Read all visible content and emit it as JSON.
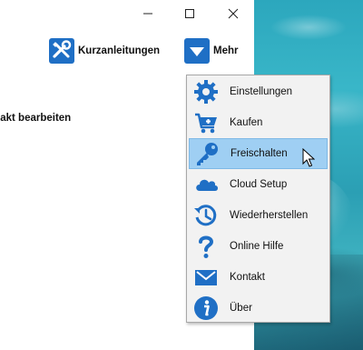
{
  "toolbar": {
    "guides_label": "Kurzanleitungen",
    "more_label": "Mehr"
  },
  "content": {
    "partial_heading": "ktakt bearbeiten"
  },
  "menu": {
    "items": [
      {
        "label": "Einstellungen",
        "icon": "gear-icon"
      },
      {
        "label": "Kaufen",
        "icon": "cart-add-icon"
      },
      {
        "label": "Freischalten",
        "icon": "key-icon",
        "highlighted": true
      },
      {
        "label": "Cloud Setup",
        "icon": "cloud-icon"
      },
      {
        "label": "Wiederherstellen",
        "icon": "history-icon"
      },
      {
        "label": "Online Hilfe",
        "icon": "question-icon"
      },
      {
        "label": "Kontakt",
        "icon": "mail-icon"
      },
      {
        "label": "Über",
        "icon": "info-icon"
      }
    ]
  },
  "colors": {
    "accent": "#1f6fc5",
    "highlight": "#9fcff3",
    "menu_bg": "#f2f2f2"
  }
}
